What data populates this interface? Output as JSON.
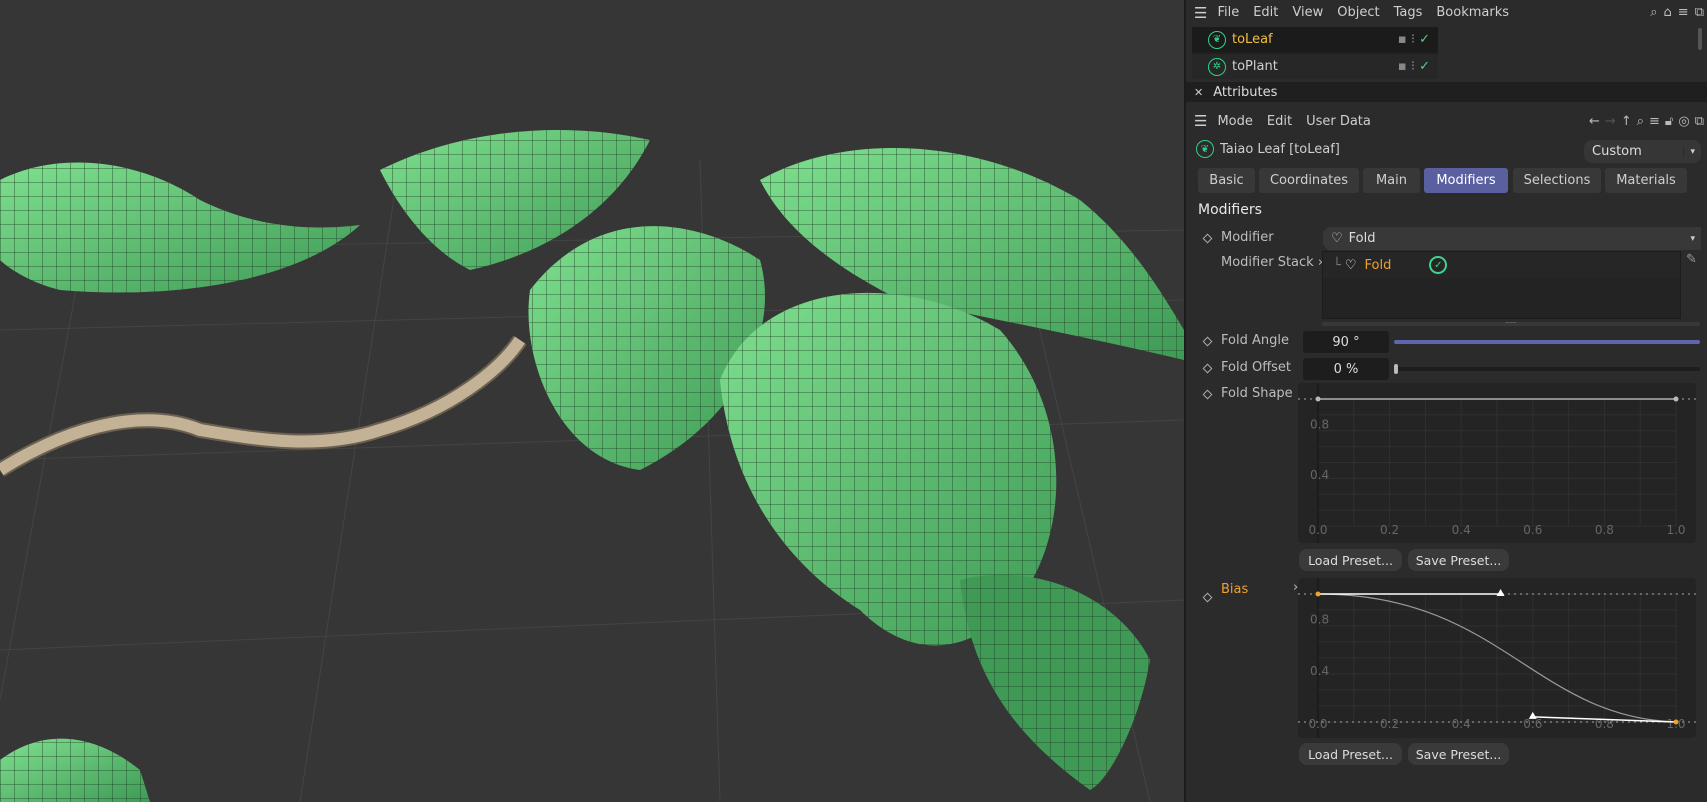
{
  "menubar": {
    "items": [
      "File",
      "Edit",
      "View",
      "Object",
      "Tags",
      "Bookmarks"
    ],
    "icons": [
      "search-icon",
      "home-icon",
      "filter-icon",
      "popout-icon"
    ]
  },
  "objects": [
    {
      "name": "toLeaf",
      "icon": "leaf-icon",
      "selected": true,
      "color": "#f0c040"
    },
    {
      "name": "toPlant",
      "icon": "plant-icon",
      "selected": false,
      "color": "#d0d0d0"
    }
  ],
  "attributes": {
    "title": "Attributes",
    "menu": [
      "Mode",
      "Edit",
      "User Data"
    ],
    "object_label": "Taiao Leaf [toLeaf]",
    "preset": "Custom",
    "tabs": [
      "Basic",
      "Coordinates",
      "Main",
      "Modifiers",
      "Selections",
      "Materials"
    ],
    "active_tab": "Modifiers",
    "section": "Modifiers",
    "modifier_label": "Modifier",
    "modifier_value": "Fold",
    "stack_label": "Modifier Stack",
    "stack_items": [
      {
        "name": "Fold",
        "enabled": true
      }
    ],
    "fold_angle_label": "Fold Angle",
    "fold_angle_value": "90 °",
    "fold_angle_fraction": 1.0,
    "fold_offset_label": "Fold Offset",
    "fold_offset_value": "0 %",
    "fold_offset_fraction": 0.0,
    "fold_shape_label": "Fold Shape",
    "bias_label": "Bias",
    "load_preset": "Load Preset...",
    "save_preset": "Save Preset..."
  },
  "chart_data": [
    {
      "type": "line",
      "title": "Fold Shape",
      "x_ticks": [
        "0.0",
        "0.2",
        "0.4",
        "0.6",
        "0.8",
        "1.0"
      ],
      "y_ticks": [
        "0.8",
        "0.4"
      ],
      "xlim": [
        0,
        1
      ],
      "ylim": [
        0,
        1
      ],
      "points": [
        [
          0,
          1
        ],
        [
          1,
          1
        ]
      ]
    },
    {
      "type": "line",
      "title": "Bias",
      "x_ticks": [
        "0.0",
        "0.2",
        "0.4",
        "0.6",
        "0.8",
        "1.0"
      ],
      "y_ticks": [
        "0.8",
        "0.4"
      ],
      "xlim": [
        0,
        1
      ],
      "ylim": [
        0,
        1
      ],
      "points": [
        [
          0,
          1
        ],
        [
          1,
          0
        ]
      ],
      "handles": [
        [
          0.51,
          1
        ],
        [
          0.6,
          0.04
        ]
      ],
      "accent": "#f0a030"
    }
  ]
}
